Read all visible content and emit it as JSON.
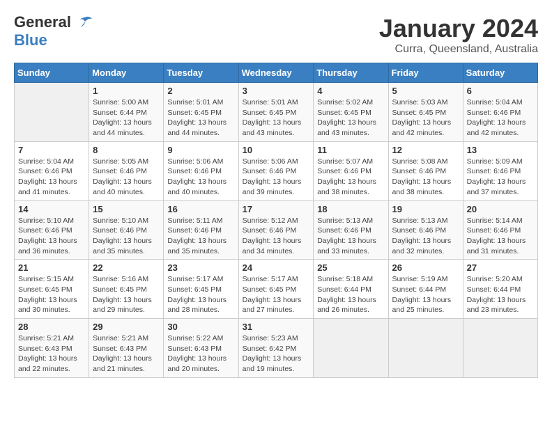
{
  "header": {
    "logo_line1": "General",
    "logo_line2": "Blue",
    "month_title": "January 2024",
    "location": "Curra, Queensland, Australia"
  },
  "weekdays": [
    "Sunday",
    "Monday",
    "Tuesday",
    "Wednesday",
    "Thursday",
    "Friday",
    "Saturday"
  ],
  "weeks": [
    [
      {
        "day": "",
        "info": ""
      },
      {
        "day": "1",
        "info": "Sunrise: 5:00 AM\nSunset: 6:44 PM\nDaylight: 13 hours\nand 44 minutes."
      },
      {
        "day": "2",
        "info": "Sunrise: 5:01 AM\nSunset: 6:45 PM\nDaylight: 13 hours\nand 44 minutes."
      },
      {
        "day": "3",
        "info": "Sunrise: 5:01 AM\nSunset: 6:45 PM\nDaylight: 13 hours\nand 43 minutes."
      },
      {
        "day": "4",
        "info": "Sunrise: 5:02 AM\nSunset: 6:45 PM\nDaylight: 13 hours\nand 43 minutes."
      },
      {
        "day": "5",
        "info": "Sunrise: 5:03 AM\nSunset: 6:45 PM\nDaylight: 13 hours\nand 42 minutes."
      },
      {
        "day": "6",
        "info": "Sunrise: 5:04 AM\nSunset: 6:46 PM\nDaylight: 13 hours\nand 42 minutes."
      }
    ],
    [
      {
        "day": "7",
        "info": "Sunrise: 5:04 AM\nSunset: 6:46 PM\nDaylight: 13 hours\nand 41 minutes."
      },
      {
        "day": "8",
        "info": "Sunrise: 5:05 AM\nSunset: 6:46 PM\nDaylight: 13 hours\nand 40 minutes."
      },
      {
        "day": "9",
        "info": "Sunrise: 5:06 AM\nSunset: 6:46 PM\nDaylight: 13 hours\nand 40 minutes."
      },
      {
        "day": "10",
        "info": "Sunrise: 5:06 AM\nSunset: 6:46 PM\nDaylight: 13 hours\nand 39 minutes."
      },
      {
        "day": "11",
        "info": "Sunrise: 5:07 AM\nSunset: 6:46 PM\nDaylight: 13 hours\nand 38 minutes."
      },
      {
        "day": "12",
        "info": "Sunrise: 5:08 AM\nSunset: 6:46 PM\nDaylight: 13 hours\nand 38 minutes."
      },
      {
        "day": "13",
        "info": "Sunrise: 5:09 AM\nSunset: 6:46 PM\nDaylight: 13 hours\nand 37 minutes."
      }
    ],
    [
      {
        "day": "14",
        "info": "Sunrise: 5:10 AM\nSunset: 6:46 PM\nDaylight: 13 hours\nand 36 minutes."
      },
      {
        "day": "15",
        "info": "Sunrise: 5:10 AM\nSunset: 6:46 PM\nDaylight: 13 hours\nand 35 minutes."
      },
      {
        "day": "16",
        "info": "Sunrise: 5:11 AM\nSunset: 6:46 PM\nDaylight: 13 hours\nand 35 minutes."
      },
      {
        "day": "17",
        "info": "Sunrise: 5:12 AM\nSunset: 6:46 PM\nDaylight: 13 hours\nand 34 minutes."
      },
      {
        "day": "18",
        "info": "Sunrise: 5:13 AM\nSunset: 6:46 PM\nDaylight: 13 hours\nand 33 minutes."
      },
      {
        "day": "19",
        "info": "Sunrise: 5:13 AM\nSunset: 6:46 PM\nDaylight: 13 hours\nand 32 minutes."
      },
      {
        "day": "20",
        "info": "Sunrise: 5:14 AM\nSunset: 6:46 PM\nDaylight: 13 hours\nand 31 minutes."
      }
    ],
    [
      {
        "day": "21",
        "info": "Sunrise: 5:15 AM\nSunset: 6:45 PM\nDaylight: 13 hours\nand 30 minutes."
      },
      {
        "day": "22",
        "info": "Sunrise: 5:16 AM\nSunset: 6:45 PM\nDaylight: 13 hours\nand 29 minutes."
      },
      {
        "day": "23",
        "info": "Sunrise: 5:17 AM\nSunset: 6:45 PM\nDaylight: 13 hours\nand 28 minutes."
      },
      {
        "day": "24",
        "info": "Sunrise: 5:17 AM\nSunset: 6:45 PM\nDaylight: 13 hours\nand 27 minutes."
      },
      {
        "day": "25",
        "info": "Sunrise: 5:18 AM\nSunset: 6:44 PM\nDaylight: 13 hours\nand 26 minutes."
      },
      {
        "day": "26",
        "info": "Sunrise: 5:19 AM\nSunset: 6:44 PM\nDaylight: 13 hours\nand 25 minutes."
      },
      {
        "day": "27",
        "info": "Sunrise: 5:20 AM\nSunset: 6:44 PM\nDaylight: 13 hours\nand 23 minutes."
      }
    ],
    [
      {
        "day": "28",
        "info": "Sunrise: 5:21 AM\nSunset: 6:43 PM\nDaylight: 13 hours\nand 22 minutes."
      },
      {
        "day": "29",
        "info": "Sunrise: 5:21 AM\nSunset: 6:43 PM\nDaylight: 13 hours\nand 21 minutes."
      },
      {
        "day": "30",
        "info": "Sunrise: 5:22 AM\nSunset: 6:43 PM\nDaylight: 13 hours\nand 20 minutes."
      },
      {
        "day": "31",
        "info": "Sunrise: 5:23 AM\nSunset: 6:42 PM\nDaylight: 13 hours\nand 19 minutes."
      },
      {
        "day": "",
        "info": ""
      },
      {
        "day": "",
        "info": ""
      },
      {
        "day": "",
        "info": ""
      }
    ]
  ]
}
